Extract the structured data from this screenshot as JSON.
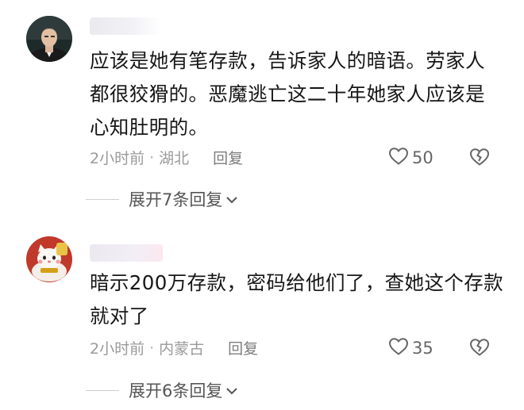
{
  "comments": [
    {
      "text": "应该是她有笔存款，告诉家人的暗语。劳家人都很狡猾的。恶魔逃亡这二十年她家人应该是心知肚明的。",
      "time": "2小时前",
      "location": "湖北",
      "reply_label": "回复",
      "likes": "50",
      "expand_label": "展开7条回复"
    },
    {
      "text": "暗示200万存款，密码给他们了，查她这个存款就对了",
      "time": "2小时前",
      "location": "内蒙古",
      "reply_label": "回复",
      "likes": "35",
      "expand_label": "展开6条回复"
    }
  ],
  "meta_separator": "·",
  "icons": {
    "like": "heart-outline-icon",
    "dislike": "broken-heart-icon",
    "expand": "chevron-down-icon"
  },
  "colors": {
    "text": "#161616",
    "meta": "#9a9a9a",
    "icon": "#666666"
  }
}
